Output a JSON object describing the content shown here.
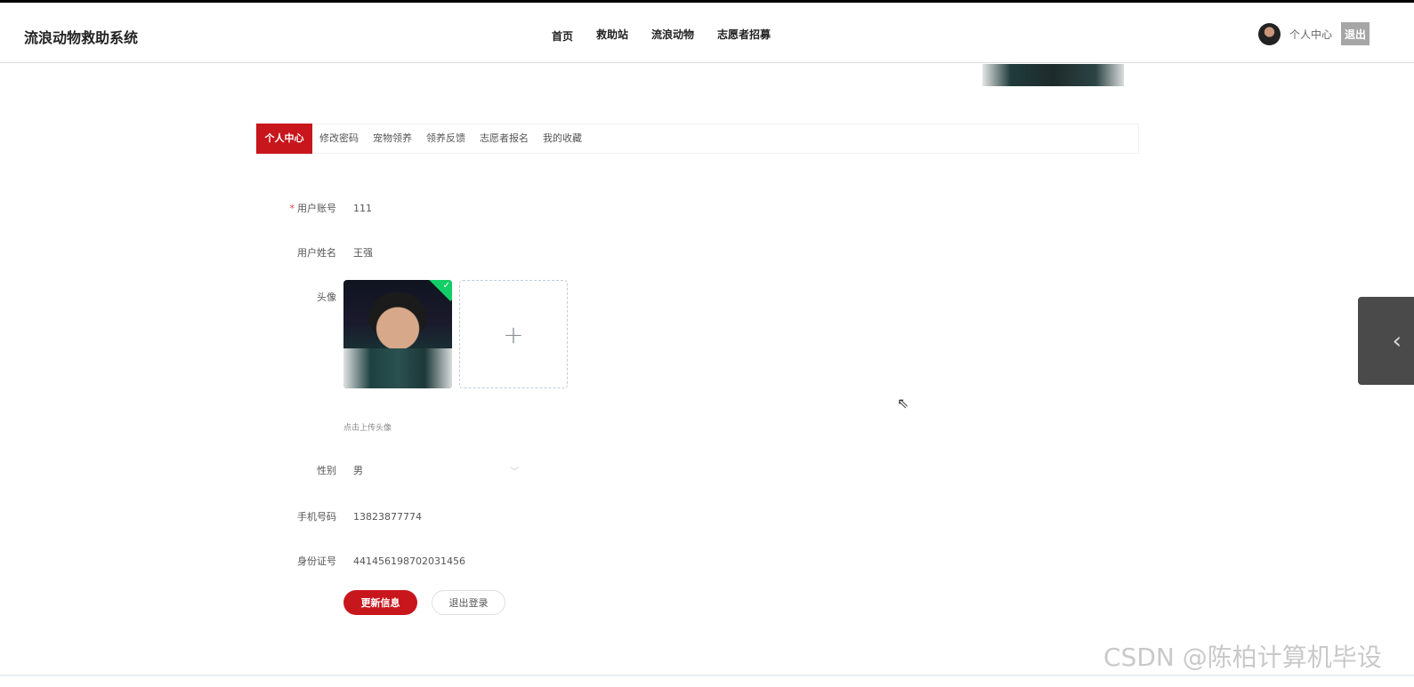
{
  "header": {
    "brand": "流浪动物救助系统",
    "nav": [
      "首页",
      "救助站",
      "流浪动物",
      "志愿者招募"
    ],
    "user_center": "个人中心",
    "logout": "退出"
  },
  "tabs": [
    "个人中心",
    "修改密码",
    "宠物领养",
    "领养反馈",
    "志愿者报名",
    "我的收藏"
  ],
  "form": {
    "account_label": "用户账号",
    "account_value": "111",
    "name_label": "用户姓名",
    "name_value": "王强",
    "avatar_label": "头像",
    "avatar_tip": "点击上传头像",
    "gender_label": "性别",
    "gender_value": "男",
    "phone_label": "手机号码",
    "phone_value": "13823877774",
    "id_label": "身份证号",
    "id_value": "441456198702031456"
  },
  "buttons": {
    "update": "更新信息",
    "logout": "退出登录"
  },
  "watermark": "CSDN @陈柏计算机毕设",
  "colors": {
    "accent": "#c8161d",
    "success": "#13ce66"
  }
}
